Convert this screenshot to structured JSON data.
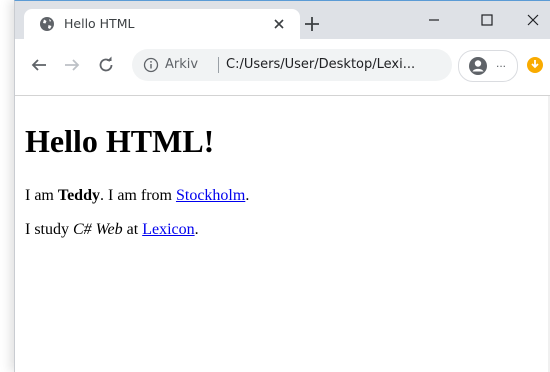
{
  "browser": {
    "tab": {
      "title": "Hello HTML",
      "favicon": "globe-icon"
    },
    "address_bar": {
      "security_label": "Arkiv",
      "url": "C:/Users/User/Desktop/Lexi..."
    },
    "profile": {
      "label": "..."
    }
  },
  "page": {
    "heading": "Hello HTML!",
    "line1": {
      "prefix": "I am ",
      "name": "Teddy",
      "middle": ". I am from ",
      "city_link": "Stockholm",
      "suffix": "."
    },
    "line2": {
      "prefix": "I study ",
      "subject": "C# Web",
      "middle": " at ",
      "school_link": "Lexicon",
      "suffix": "."
    }
  },
  "colors": {
    "titlebar": "#dee1e6",
    "omnibox": "#f1f3f4",
    "link": "#0000ee",
    "extension_accent": "#f9ab00"
  }
}
